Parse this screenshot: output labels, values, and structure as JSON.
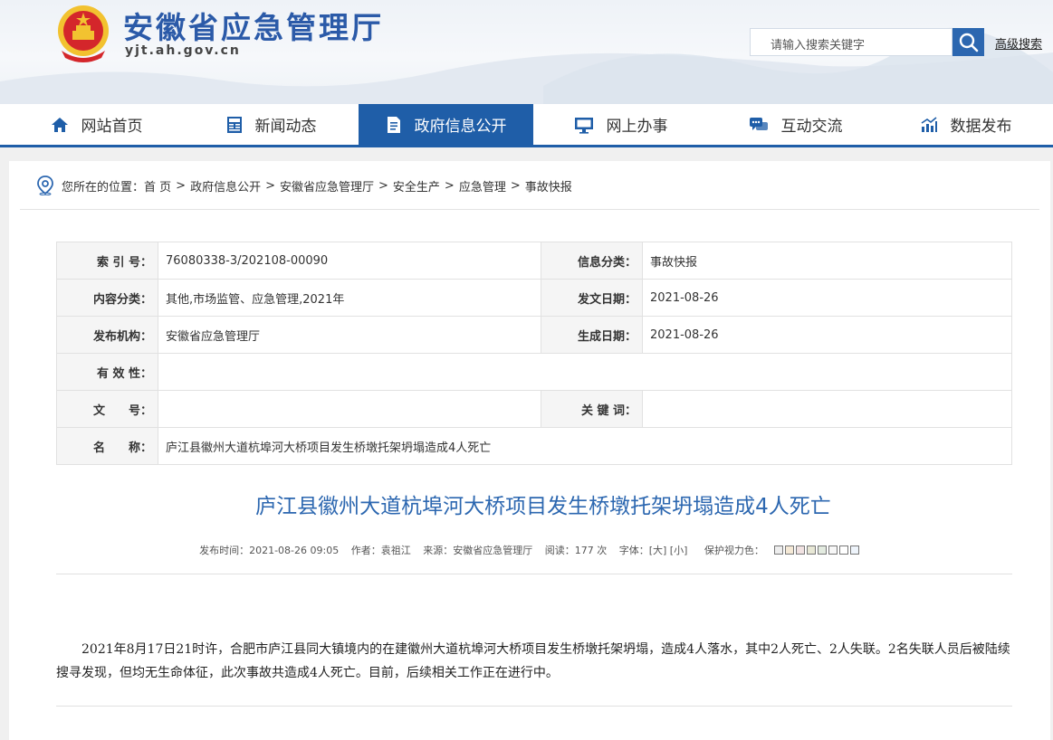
{
  "header": {
    "site_title": "安徽省应急管理厅",
    "site_domain": "yjt.ah.gov.cn",
    "search_placeholder": "请输入搜索关键字",
    "advanced_search": "高级搜索"
  },
  "nav": {
    "items": [
      {
        "label": "网站首页",
        "icon": "home-icon"
      },
      {
        "label": "新闻动态",
        "icon": "news-icon"
      },
      {
        "label": "政府信息公开",
        "icon": "document-icon",
        "active": true
      },
      {
        "label": "网上办事",
        "icon": "monitor-icon"
      },
      {
        "label": "互动交流",
        "icon": "chat-icon"
      },
      {
        "label": "数据发布",
        "icon": "chart-icon"
      }
    ],
    "active_color": "#1f5ea8"
  },
  "breadcrumb": {
    "prefix": "您所在的位置：",
    "items": [
      "首 页",
      "政府信息公开",
      "安徽省应急管理厅",
      "安全生产",
      "应急管理",
      "事故快报"
    ],
    "separator": ">"
  },
  "info": {
    "index_label": "索 引 号：",
    "index_value": "76080338-3/202108-00090",
    "category_label": "信息分类：",
    "category_value": "事故快报",
    "content_label": "内容分类：",
    "content_value": "其他,市场监管、应急管理,2021年",
    "issue_date_label": "发文日期：",
    "issue_date_value": "2021-08-26",
    "publisher_label": "发布机构：",
    "publisher_value": "安徽省应急管理厅",
    "created_date_label": "生成日期：",
    "created_date_value": "2021-08-26",
    "validity_label": "有 效 性：",
    "validity_value": "",
    "doc_no_label": "文　　号：",
    "doc_no_value": "",
    "keywords_label": "关 键 词：",
    "keywords_value": "",
    "name_label": "名　　称：",
    "name_value": "庐江县徽州大道杭埠河大桥项目发生桥墩托架坍塌造成4人死亡"
  },
  "article": {
    "title": "庐江县徽州大道杭埠河大桥项目发生桥墩托架坍塌造成4人死亡",
    "published": "发布时间：2021-08-26 09:05",
    "author": "作者：袁祖江",
    "source": "来源：安徽省应急管理厅",
    "reads": "阅读：177 次",
    "font_size": "字体：[大] [小]",
    "eye_care": "保护视力色：",
    "eye_colors": [
      "#eeeeee",
      "#f5e9d6",
      "#f1e2e2",
      "#e8e8d6",
      "#e3ebe0",
      "#f7f7f7",
      "#ffffff",
      "#eef4fb"
    ],
    "body": "2021年8月17日21时许，合肥市庐江县同大镇境内的在建徽州大道杭埠河大桥项目发生桥墩托架坍塌，造成4人落水，其中2人死亡、2人失联。2名失联人员后被陆续搜寻发现，但均无生命体征，此次事故共造成4人死亡。目前，后续相关工作正在进行中。"
  }
}
